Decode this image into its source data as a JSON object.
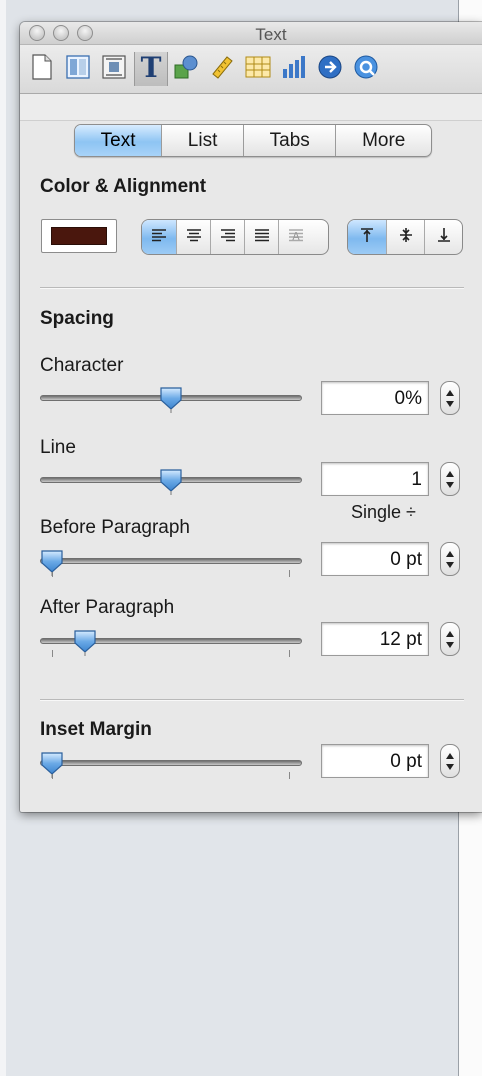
{
  "window": {
    "title": "Text"
  },
  "toolbar": {
    "items": [
      {
        "name": "document-icon",
        "selected": false
      },
      {
        "name": "layout-icon",
        "selected": false
      },
      {
        "name": "wrap-icon",
        "selected": false
      },
      {
        "name": "text-icon",
        "selected": true
      },
      {
        "name": "graphic-icon",
        "selected": false
      },
      {
        "name": "metrics-icon",
        "selected": false
      },
      {
        "name": "table-icon",
        "selected": false
      },
      {
        "name": "chart-icon",
        "selected": false
      },
      {
        "name": "link-icon",
        "selected": false
      },
      {
        "name": "quicktime-icon",
        "selected": false
      }
    ]
  },
  "tabs": [
    {
      "label": "Text",
      "active": true
    },
    {
      "label": "List",
      "active": false
    },
    {
      "label": "Tabs",
      "active": false
    },
    {
      "label": "More",
      "active": false
    }
  ],
  "color_alignment": {
    "heading": "Color & Alignment",
    "text_color": "#4a170d",
    "horizontal_selected": "left",
    "vertical_selected": "top"
  },
  "spacing": {
    "heading": "Spacing",
    "character": {
      "label": "Character",
      "value": "0%",
      "slider_fraction": 0.5
    },
    "line": {
      "label": "Line",
      "value": "1",
      "mode": "Single ÷",
      "slider_fraction": 0.5
    },
    "before_paragraph": {
      "label": "Before Paragraph",
      "value": "0 pt",
      "slider_fraction": 0.0
    },
    "after_paragraph": {
      "label": "After Paragraph",
      "value": "12 pt",
      "slider_fraction": 0.14
    }
  },
  "inset_margin": {
    "heading": "Inset Margin",
    "value": "0 pt",
    "slider_fraction": 0.0
  },
  "colors": {
    "accent": "#8ec4f3",
    "window_bg": "#e8e8e8"
  }
}
